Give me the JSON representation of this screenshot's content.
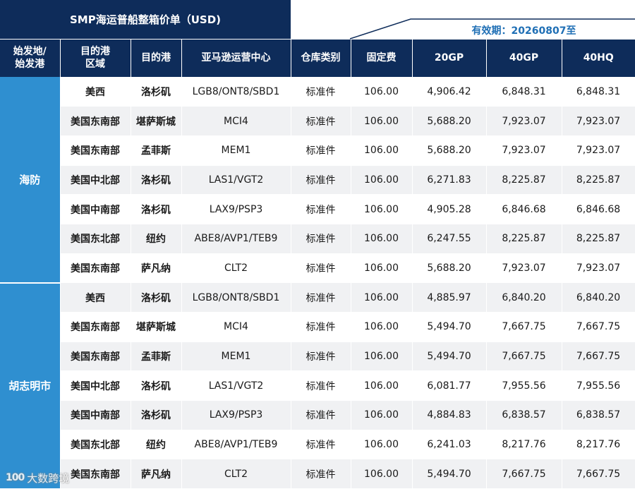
{
  "title": "SMP海运普船整箱价单（USD)",
  "validity": "有效期：20260807至",
  "headers": [
    "始发地/\n始发港",
    "目的港\n区域",
    "目的港",
    "亚马逊运营中心",
    "仓库类别",
    "固定费",
    "20GP",
    "40GP",
    "40HQ"
  ],
  "groups": [
    {
      "origin": "海防",
      "rows": [
        [
          "美西",
          "洛杉矶",
          "LGB8/ONT8/SBD1",
          "标准件",
          "106.00",
          "4,906.42",
          "6,848.31",
          "6,848.31"
        ],
        [
          "美国东南部",
          "堪萨斯城",
          "MCI4",
          "标准件",
          "106.00",
          "5,688.20",
          "7,923.07",
          "7,923.07"
        ],
        [
          "美国东南部",
          "孟菲斯",
          "MEM1",
          "标准件",
          "106.00",
          "5,688.20",
          "7,923.07",
          "7,923.07"
        ],
        [
          "美国中北部",
          "洛杉矶",
          "LAS1/VGT2",
          "标准件",
          "106.00",
          "6,271.83",
          "8,225.87",
          "8,225.87"
        ],
        [
          "美国中南部",
          "洛杉矶",
          "LAX9/PSP3",
          "标准件",
          "106.00",
          "4,905.28",
          "6,846.68",
          "6,846.68"
        ],
        [
          "美国东北部",
          "纽约",
          "ABE8/AVP1/TEB9",
          "标准件",
          "106.00",
          "6,247.55",
          "8,225.87",
          "8,225.87"
        ],
        [
          "美国东南部",
          "萨凡纳",
          "CLT2",
          "标准件",
          "106.00",
          "5,688.20",
          "7,923.07",
          "7,923.07"
        ]
      ]
    },
    {
      "origin": "胡志明市",
      "rows": [
        [
          "美西",
          "洛杉矶",
          "LGB8/ONT8/SBD1",
          "标准件",
          "106.00",
          "4,885.97",
          "6,840.20",
          "6,840.20"
        ],
        [
          "美国东南部",
          "堪萨斯城",
          "MCI4",
          "标准件",
          "106.00",
          "5,494.70",
          "7,667.75",
          "7,667.75"
        ],
        [
          "美国东南部",
          "孟菲斯",
          "MEM1",
          "标准件",
          "106.00",
          "5,494.70",
          "7,667.75",
          "7,667.75"
        ],
        [
          "美国中北部",
          "洛杉矶",
          "LAS1/VGT2",
          "标准件",
          "106.00",
          "6,081.77",
          "7,955.56",
          "7,955.56"
        ],
        [
          "美国中南部",
          "洛杉矶",
          "LAX9/PSP3",
          "标准件",
          "106.00",
          "4,884.83",
          "6,838.57",
          "6,838.57"
        ],
        [
          "美国东北部",
          "纽约",
          "ABE8/AVP1/TEB9",
          "标准件",
          "106.00",
          "6,241.03",
          "8,217.76",
          "8,217.76"
        ],
        [
          "美国东南部",
          "萨凡纳",
          "CLT2",
          "标准件",
          "106.00",
          "5,494.70",
          "7,667.75",
          "7,667.75"
        ]
      ]
    }
  ],
  "watermark": {
    "logo": "100",
    "text": "大数跨境"
  },
  "colors": {
    "header_bg": "#0e2c5a",
    "origin_bg": "#2f8fd0",
    "accent_text": "#1f6fb5",
    "stripe": "#f0f1f3"
  }
}
